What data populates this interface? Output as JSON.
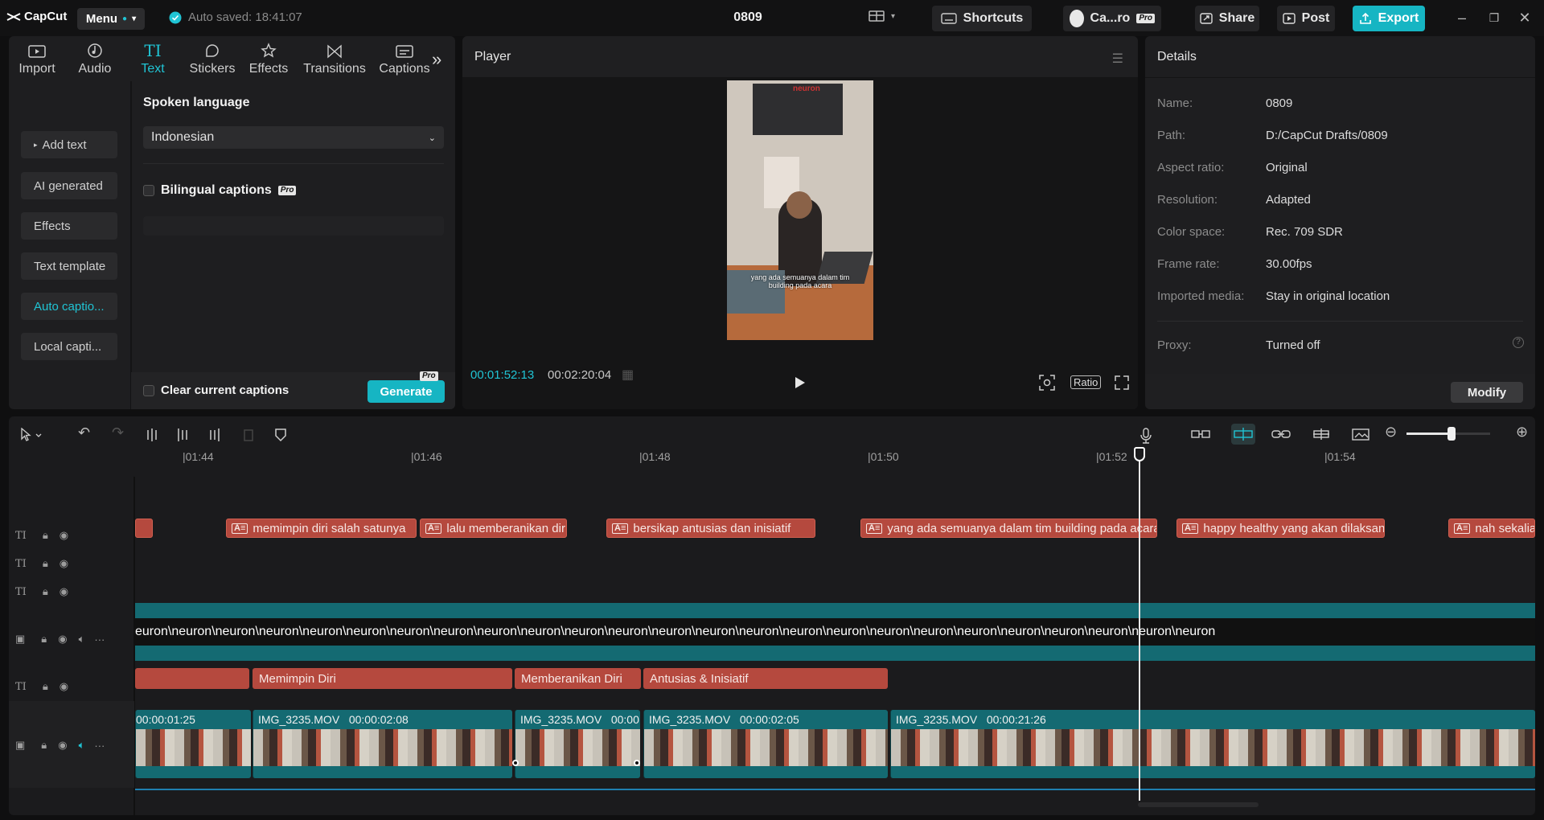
{
  "app": {
    "logo": "CapCut",
    "menu_label": "Menu",
    "autosave": "Auto saved: 18:41:07",
    "project_title": "0809"
  },
  "topbar": {
    "shortcuts_label": "Shortcuts",
    "account_label": "Ca...ro",
    "pro_badge": "Pro",
    "share_label": "Share",
    "post_label": "Post",
    "export_label": "Export"
  },
  "tool_tabs": [
    {
      "label": "Import",
      "icon": "import-icon"
    },
    {
      "label": "Audio",
      "icon": "audio-icon"
    },
    {
      "label": "Text",
      "icon": "text-icon",
      "active": true
    },
    {
      "label": "Stickers",
      "icon": "stickers-icon"
    },
    {
      "label": "Effects",
      "icon": "effects-icon"
    },
    {
      "label": "Transitions",
      "icon": "transitions-icon"
    },
    {
      "label": "Captions",
      "icon": "captions-icon"
    }
  ],
  "text_subnav": [
    {
      "label": "Add text"
    },
    {
      "label": "AI generated"
    },
    {
      "label": "Effects"
    },
    {
      "label": "Text template"
    },
    {
      "label": "Auto captio...",
      "active": true
    },
    {
      "label": "Local capti..."
    }
  ],
  "captions_panel": {
    "spoken_language_label": "Spoken language",
    "spoken_language_value": "Indonesian",
    "bilingual_label": "Bilingual captions",
    "bilingual_badge": "Pro",
    "clear_label": "Clear current captions",
    "generate_label": "Generate",
    "generate_badge": "Pro"
  },
  "player": {
    "title": "Player",
    "current_time": "00:01:52:13",
    "total_time": "00:02:20:04",
    "ratio_label": "Ratio",
    "video_caption": "yang ada semuanya dalam tim building pada acara",
    "video_watermark": "neuron"
  },
  "details": {
    "title": "Details",
    "rows": [
      {
        "key": "Name:",
        "value": "0809"
      },
      {
        "key": "Path:",
        "value": "D:/CapCut Drafts/0809"
      },
      {
        "key": "Aspect ratio:",
        "value": "Original"
      },
      {
        "key": "Resolution:",
        "value": "Adapted"
      },
      {
        "key": "Color space:",
        "value": "Rec. 709 SDR"
      },
      {
        "key": "Frame rate:",
        "value": "30.00fps"
      },
      {
        "key": "Imported media:",
        "value": "Stay in original location"
      }
    ],
    "proxy_key": "Proxy:",
    "proxy_value": "Turned off",
    "modify_label": "Modify"
  },
  "timeline": {
    "ruler": [
      "|01:44",
      "|01:46",
      "|01:48",
      "|01:50",
      "|01:52",
      "|01:54"
    ],
    "caption_clips": [
      "memimpin diri salah satunya",
      "lalu memberanikan diri",
      "bersikap antusias dan inisiatif",
      "yang ada semuanya dalam tim building pada acara",
      "happy healthy yang akan dilaksan",
      "nah sekalian"
    ],
    "text_tag": "A≡",
    "overlay_text": "euron\\neuron\\neuron\\neuron\\neuron\\neuron\\neuron\\neuron\\neuron\\neuron\\neuron\\neuron\\neuron\\neuron\\neuron\\neuron\\neuron\\neuron\\neuron\\neuron\\neuron\\neuron\\neuron\\neuron\\neuron",
    "title_clips": [
      "Memimpin Diri",
      "Memberanikan Diri",
      "Antusias & Inisiatif"
    ],
    "video_clips": [
      {
        "name": "",
        "duration": "00:00:01:25"
      },
      {
        "name": "IMG_3235.MOV",
        "duration": "00:00:02:08"
      },
      {
        "name": "IMG_3235.MOV",
        "duration": "00:00:"
      },
      {
        "name": "IMG_3235.MOV",
        "duration": "00:00:02:05"
      },
      {
        "name": "IMG_3235.MOV",
        "duration": "00:00:21:26"
      }
    ]
  },
  "colors": {
    "accent": "#20c4d4",
    "text_clip": "#b5493e",
    "video_clip": "#146a72"
  }
}
